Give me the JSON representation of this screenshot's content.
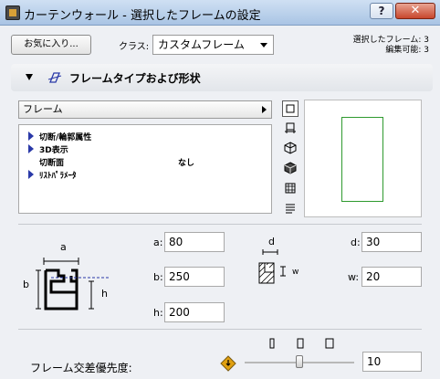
{
  "window": {
    "title": "カーテンウォール - 選択したフレームの設定",
    "help_label": "?",
    "close_label": "✕"
  },
  "top": {
    "favorites_label": "お気に入り...",
    "class_label": "クラス:",
    "class_value": "カスタムフレーム",
    "selected_count": "選択したフレーム: 3",
    "editable_count": "編集可能: 3"
  },
  "panel": {
    "title": "フレームタイプおよび形状",
    "frame_dropdown": "フレーム",
    "tree": [
      {
        "label": "切断/輪郭属性",
        "expandable": true,
        "value": ""
      },
      {
        "label": "3D表示",
        "expandable": true,
        "value": ""
      },
      {
        "label": "切断面",
        "expandable": false,
        "value": "なし"
      },
      {
        "label": "ﾘｽﾄﾊﾟﾗﾒｰﾀ",
        "expandable": true,
        "value": ""
      }
    ]
  },
  "params": {
    "a_label": "a:",
    "a_value": "80",
    "b_label": "b:",
    "b_value": "250",
    "h_label": "h:",
    "h_value": "200",
    "d_label": "d:",
    "d_value": "30",
    "w_label": "w:",
    "w_value": "20",
    "diagram_a": "a",
    "diagram_b": "b",
    "diagram_h": "h",
    "diagram_d": "d",
    "diagram_w": "w"
  },
  "bottom": {
    "priority_label": "フレーム交差優先度:",
    "priority_value": "10"
  },
  "colors": {
    "preview_frame": "#2e9a2e",
    "tree_arrow": "#2a39a8",
    "warning": "#e0a010"
  }
}
